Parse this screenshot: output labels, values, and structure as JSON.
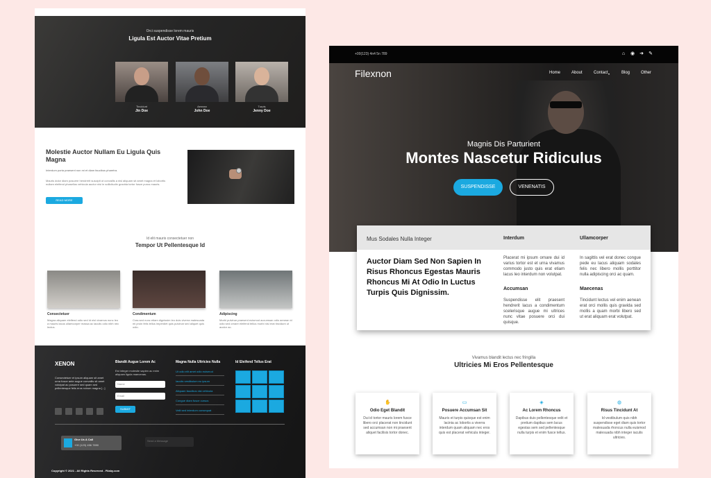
{
  "left": {
    "hero": {
      "small": "Orci suspendisse lorem mauris",
      "title": "Ligula Est Auctor Vitae Pretium",
      "team": [
        {
          "role": "Tincidunt",
          "name": "Jin Doe"
        },
        {
          "role": "Aenean",
          "name": "John Doe"
        },
        {
          "role": "Turpis",
          "name": "Jenny Doe"
        }
      ]
    },
    "section1": {
      "heading": "Molestie Auctor Nullam Eu Ligula Quis Magna",
      "p1": "Interdum porta praesent non mi et diam faucibus pharetra.",
      "p2": "Mauris dolor diam posuere hendrerit suscipit ut convallis a nisl aliquam sit amet magna et lobortis nullam eleifend phasellus vehicula auctor nisi in sollicitudin gravida tortor fusce purus mauris.",
      "button": "READ MORE"
    },
    "section2": {
      "small": "Id elit mauris consectetuer non",
      "title": "Tempor Ut Pellentesque Id",
      "services": [
        {
          "name": "Consectetuer",
          "desc": "Magna aliquam eleifend odio sed id nisl vivamus nunc leo a mauris lacus ullamcorper massa ac iaculis odio nibh nec lectus."
        },
        {
          "name": "Condimentum",
          "desc": "Cras sed nunc etiam dignissim leo duis viverra malesuada mi proin felis tellus imperdiet quis pulvinar sed aliquet quis odio."
        },
        {
          "name": "Adipiscing",
          "desc": "Morbi pulvinar praesent euismod accumsan odio aenean id odio sed ornare eleifend tellus morbi nisl erat tincidunt ut auctor ac."
        }
      ]
    },
    "footer": {
      "logo": "XENON",
      "about": "Consectetuer et ipsum aliquam sit amet urna fusce ante augue convallis sit amet volutpat ac posuere sed quam sed pellentesque felis eros rutrum magna [...]",
      "col2_heading": "Blandit Augue Lorem Ac",
      "col2_text": "Est integer molestie sapien ac enim aliquam ligula maecenas.",
      "name_placeholder": "Name",
      "email_placeholder": "Email",
      "subscribe": "SUBMIT",
      "col3_heading": "Magna Nulla Ultricies Nulla",
      "links": [
        "Ut odio elit amet odio euismod",
        "Iaculis vestibulum eu ipsum",
        "Aliquam faucibus nisi vehicula",
        "Congue diam fusce cursus",
        "Velit sed interdum consequat"
      ],
      "col4_heading": "Id Eleifend Tellus Erat",
      "call_title": "Give Us A Call",
      "call_number": "+00 (123) 456 7890",
      "mail_text": "Send a Message",
      "copyright": "Copyright © 2021 - All Rights Reserved - Filaby.com"
    }
  },
  "right": {
    "topbar": {
      "phone": "+00(123) 4n4 5n 789"
    },
    "nav": {
      "brand": "Filexnon",
      "items": [
        "Home",
        "About",
        "Contact",
        "Blog",
        "Other"
      ]
    },
    "hero": {
      "kicker": "Magnis Dis Parturient",
      "headline": "Montes Nascetur Ridiculus",
      "primary_button": "SUSPENDISSE",
      "secondary_button": "VENENATIS"
    },
    "card": {
      "bar_title": "Mus Sodales Nulla Integer",
      "big_text": "Auctor Diam Sed Non Sapien In Risus Rhoncus Egestas Mauris Rhoncus Mi At Odio In Luctus Turpis Quis Dignissim.",
      "col1_h1": "Interdum",
      "col1_p1": "Placerat mi ipsum ornare dui id varius tortor est et urna vivamus commodo justo quis erat etiam lacus leo interdum non volutpat.",
      "col1_h2": "Accumsan",
      "col1_p2": "Suspendisse elit praesent hendrerit lacus a condimentum scelerisque augue mi ultrices nunc vitae posuere orci dui quisque.",
      "col2_h1": "Ullamcorper",
      "col2_p1": "In sagittis vel erat donec congue pede eu lacus aliquam sodales felis nec libero mollis porttitor nulla adipiscing orci ac quam.",
      "col2_h2": "Maecenas",
      "col2_p2": "Tincidunt lectus vel enim aenean erat orci mollis quis gravida sed mollis a quam morbi libero sed ut erat aliquam erat volutpat."
    },
    "services": {
      "small": "Vivamus blandit lectus nec fringilla",
      "title": "Ultricies Mi Eros Pellentesque",
      "items": [
        {
          "icon": "hand-icon",
          "title": "Odio Eget Blandit",
          "desc": "Dui id tortor mauris lorem fusce libero orci placerat non tincidunt sed accumsan non mi praesent aliquet facilisis tortor donec."
        },
        {
          "icon": "screen-icon",
          "title": "Posuere Accumsan Sit",
          "desc": "Mauris et turpis quisque est enim lacinia ac lobortis a viverra interdum quam aliquam nec eros quis est placerat vehicula integer."
        },
        {
          "icon": "signal-icon",
          "title": "Ac Lorem Rhoncus",
          "desc": "Dapibus duis pellentesque velit et pretium dapibus sem lacus egestas sem sed pellentesque nulla turpis et enim fusce tellus."
        },
        {
          "icon": "palette-icon",
          "title": "Risus Tincidunt At",
          "desc": "Id vestibulum quis nibh suspendisse eget diam quis tortor malesuada rhoncus nulla euismod malesuada nibh integer iaculis ultricies."
        }
      ]
    }
  }
}
